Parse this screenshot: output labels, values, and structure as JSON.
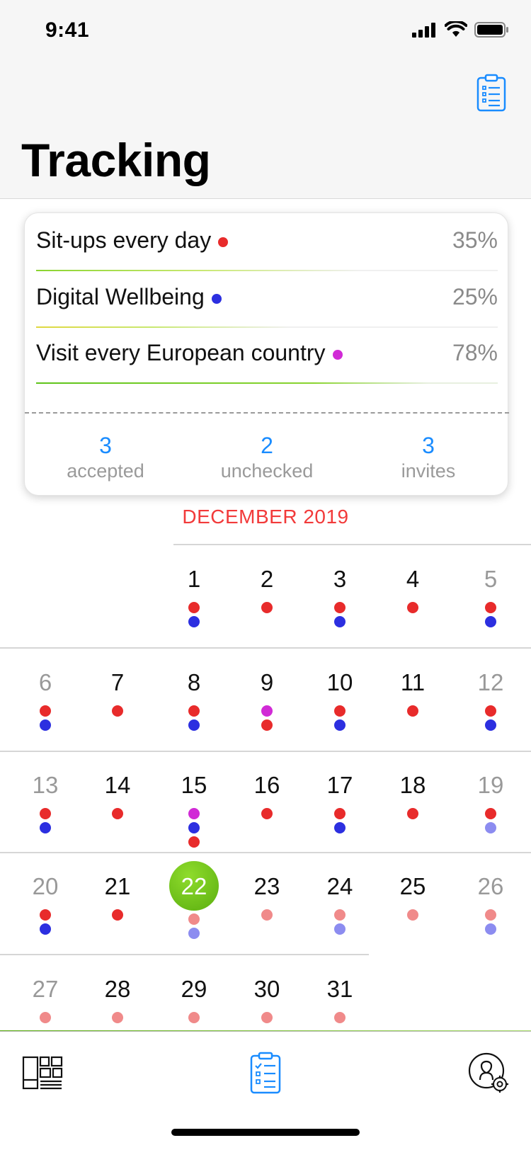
{
  "status_bar": {
    "time": "9:41"
  },
  "header": {
    "title": "Tracking",
    "clipboard_icon": "clipboard-list-icon"
  },
  "goals": [
    {
      "name": "Sit-ups every day",
      "percent": "35%",
      "color": "#e82b2b"
    },
    {
      "name": "Digital Wellbeing",
      "percent": "25%",
      "color": "#2c2fe0"
    },
    {
      "name": "Visit every European country",
      "percent": "78%",
      "color": "#d12ad6"
    }
  ],
  "stats": [
    {
      "value": "3",
      "label": "accepted"
    },
    {
      "value": "2",
      "label": "unchecked"
    },
    {
      "value": "3",
      "label": "invites"
    }
  ],
  "calendar": {
    "month": "DECEMBER 2019",
    "today": "22",
    "weeks": [
      [
        {
          "day": "1",
          "weekend": false,
          "dots": [
            "red",
            "blue"
          ]
        },
        {
          "day": "2",
          "weekend": false,
          "dots": [
            "red"
          ]
        },
        {
          "day": "3",
          "weekend": false,
          "dots": [
            "red",
            "blue"
          ]
        },
        {
          "day": "4",
          "weekend": false,
          "dots": [
            "red"
          ]
        },
        {
          "day": "5",
          "weekend": true,
          "dots": [
            "red",
            "blue"
          ]
        }
      ],
      [
        {
          "day": "6",
          "weekend": true,
          "dots": [
            "red",
            "blue"
          ]
        },
        {
          "day": "7",
          "weekend": false,
          "dots": [
            "red"
          ]
        },
        {
          "day": "8",
          "weekend": false,
          "dots": [
            "red",
            "blue"
          ]
        },
        {
          "day": "9",
          "weekend": false,
          "dots": [
            "magenta",
            "red"
          ]
        },
        {
          "day": "10",
          "weekend": false,
          "dots": [
            "red",
            "blue"
          ]
        },
        {
          "day": "11",
          "weekend": false,
          "dots": [
            "red"
          ]
        },
        {
          "day": "12",
          "weekend": true,
          "dots": [
            "red",
            "blue"
          ]
        }
      ],
      [
        {
          "day": "13",
          "weekend": true,
          "dots": [
            "red",
            "blue"
          ]
        },
        {
          "day": "14",
          "weekend": false,
          "dots": [
            "red"
          ]
        },
        {
          "day": "15",
          "weekend": false,
          "dots": [
            "magenta",
            "blue",
            "red"
          ]
        },
        {
          "day": "16",
          "weekend": false,
          "dots": [
            "red"
          ]
        },
        {
          "day": "17",
          "weekend": false,
          "dots": [
            "red",
            "blue"
          ]
        },
        {
          "day": "18",
          "weekend": false,
          "dots": [
            "red"
          ]
        },
        {
          "day": "19",
          "weekend": true,
          "dots": [
            "red",
            "blue-faded"
          ]
        }
      ],
      [
        {
          "day": "20",
          "weekend": true,
          "dots": [
            "red",
            "blue"
          ]
        },
        {
          "day": "21",
          "weekend": false,
          "dots": [
            "red"
          ]
        },
        {
          "day": "22",
          "weekend": false,
          "dots": [
            "red-faded",
            "blue-faded"
          ]
        },
        {
          "day": "23",
          "weekend": false,
          "dots": [
            "red-faded"
          ]
        },
        {
          "day": "24",
          "weekend": false,
          "dots": [
            "red-faded",
            "blue-faded"
          ]
        },
        {
          "day": "25",
          "weekend": false,
          "dots": [
            "red-faded"
          ]
        },
        {
          "day": "26",
          "weekend": true,
          "dots": [
            "red-faded",
            "blue-faded"
          ]
        }
      ],
      [
        {
          "day": "27",
          "weekend": true,
          "dots": [
            "red-faded"
          ]
        },
        {
          "day": "28",
          "weekend": false,
          "dots": [
            "red-faded"
          ]
        },
        {
          "day": "29",
          "weekend": false,
          "dots": [
            "red-faded"
          ]
        },
        {
          "day": "30",
          "weekend": false,
          "dots": [
            "red-faded"
          ]
        },
        {
          "day": "31",
          "weekend": false,
          "dots": [
            "red-faded"
          ]
        }
      ]
    ]
  },
  "colors": {
    "red": "#e82b2b",
    "red-faded": "#f08a8a",
    "blue": "#2c2fe0",
    "blue-faded": "#8c8cf0",
    "magenta": "#d12ad6",
    "accent": "#1a8cff",
    "today": "#5aae0f",
    "weekday_text": "#111111",
    "weekend_text": "#999999",
    "month_label": "#f23a3a"
  },
  "tabbar": {
    "tabs": [
      {
        "icon": "dashboard-icon",
        "active": false
      },
      {
        "icon": "clipboard-list-icon",
        "active": true
      },
      {
        "icon": "profile-settings-icon",
        "active": false
      }
    ]
  }
}
